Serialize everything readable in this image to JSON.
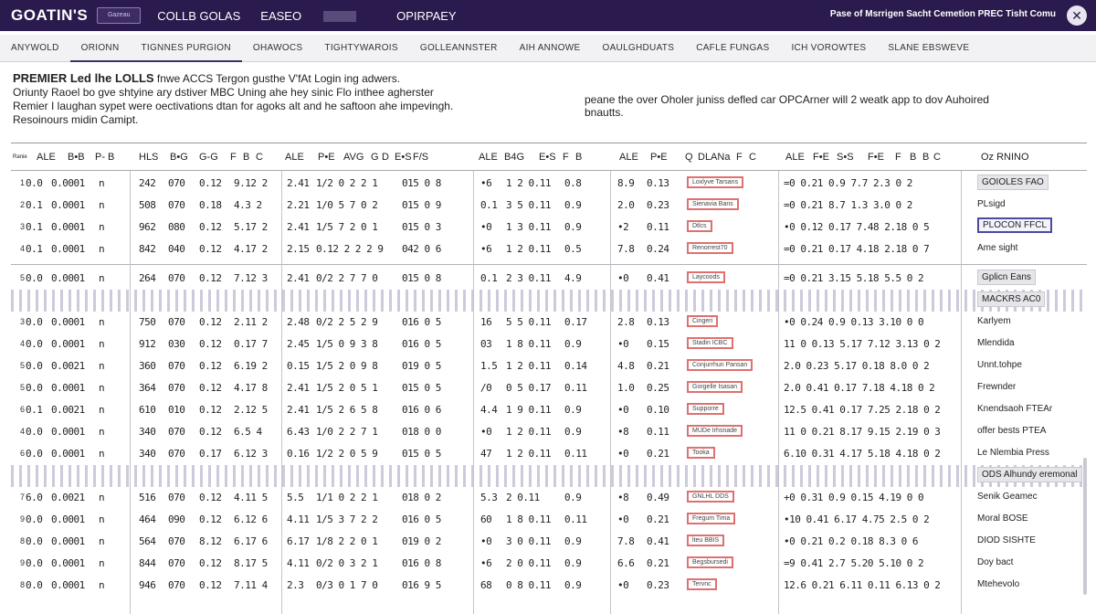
{
  "header": {
    "logo": "GOATIN'S",
    "badge": "Gazeau",
    "nav": [
      "COLLB GOLAS",
      "EASEO",
      "OPIRPAEY"
    ],
    "right_text": "Pase of Msrrigen Sacht Cemetion PREC Tisht Comu",
    "close_icon": "close-icon"
  },
  "tabs": [
    "ANYWOLD",
    "ORIONN",
    "TIGNNES PURGION",
    "OHAWOCS",
    "TIGHTYWAROIS",
    "GOLLEANNSTER",
    "AIH ANNOWE",
    "OAULGHDUATS",
    "CAFLE FUNGAS",
    "ICH VOROWTES",
    "SLANE EBSWEVE"
  ],
  "intro": {
    "heading": "PREMIER Led lhe LOLLS",
    "heading_rest": " fnwe ACCS Tergon gusthe V'fAt Login ing adwers.",
    "lines": [
      "Oriunty Raoel bo gve shtyine ary dstiver MBC Uning ahe hey sinic Flo inthee agherster",
      "Remier I laughan sypet were oectivations dtan for agoks alt and he saftoon ahe impevingh.",
      "Resoinours midin Camipt."
    ],
    "right_line1": "peane the over Oholer juniss defled car OPCArner will 2 weatk app to dov Auhoired",
    "right_line2": "bnautts."
  },
  "columns": [
    "Ranie",
    "ALE",
    "B•B",
    "P- B",
    "HLS",
    "B•G",
    "G-G",
    "F",
    "B",
    "C",
    "ALE",
    "P•E",
    "AVG",
    "G",
    "D",
    "E•S",
    "F/S",
    "ALE",
    "B4G",
    "E•S",
    "F",
    "B",
    "ALE",
    "P•E",
    "Q",
    "DLANa",
    "F",
    "C",
    "ALE",
    "F•E",
    "S•S",
    "F•E",
    "F",
    "B",
    "B",
    "C",
    "Oz RNINO"
  ],
  "rows": [
    {
      "n": "1",
      "a": "0.0",
      "b": "0.0001",
      "c": "n",
      "d": "242",
      "e": "070",
      "f": "0.12",
      "g": "9.12 2",
      "h": "2.41",
      "i": "1/2 0 2 2 1",
      "j": "015 0 8",
      "k": "•6",
      "l": "1 2 0.11",
      "m": "0.8",
      "o": "8.9",
      "p": "0.13",
      "pill": "Loxlyve Tarsans",
      "q": "=0 0.21 0.9 7.7 2.3 0 2",
      "side": "GOIOLES FAO",
      "side_style": "boxed"
    },
    {
      "n": "2",
      "a": "0.1",
      "b": "0.0001",
      "c": "n",
      "d": "508",
      "e": "070",
      "f": "0.18",
      "g": "4.3 2",
      "h": "2.21",
      "i": "1/0 5 7 0 2",
      "j": "015 0 9",
      "k": "0.1",
      "l": "3 5 0.11",
      "m": "0.9",
      "o": "2.0",
      "p": "0.23",
      "pill": "Sienavia Bans",
      "q": "=0 0.21 8.7 1.3 3.0 0 2",
      "side": "PLsigd",
      "side_style": ""
    },
    {
      "n": "3",
      "a": "0.1",
      "b": "0.0001",
      "c": "n",
      "d": "962",
      "e": "080",
      "f": "0.12",
      "g": "5.17 2",
      "h": "2.41",
      "i": "1/5 7 2 0 1",
      "j": "015 0 3",
      "k": "•0",
      "l": "1 3 0.11",
      "m": "0.9",
      "o": "•2",
      "p": "0.11",
      "pill": "Dtlcs",
      "q": "•0 0.12 0.17 7.48 2.18 0 5",
      "side": "PLOCON FFCL",
      "side_style": "outlined"
    },
    {
      "n": "4",
      "a": "0.1",
      "b": "0.0001",
      "c": "n",
      "d": "842",
      "e": "040",
      "f": "0.12",
      "g": "4.17 2",
      "h": "2.15",
      "i": "0.12 2 2 2 9",
      "j": "042 0 6",
      "k": "•6",
      "l": "1 2 0.11",
      "m": "0.5",
      "o": "7.8",
      "p": "0.24",
      "pill": "Renorrest70",
      "q": "=0 0.21 0.17 4.18 2.18 0 7",
      "side": "Ame sight",
      "side_style": ""
    },
    {
      "n": "5",
      "a": "0.0",
      "b": "0.0001",
      "c": "n",
      "d": "264",
      "e": "070",
      "f": "0.12",
      "g": "7.12 3",
      "h": "2.41",
      "i": "0/2 2 7 7 0",
      "j": "015 0 8",
      "k": "0.1",
      "l": "2 3 0.11",
      "m": "4.9",
      "o": "•0",
      "p": "0.41",
      "pill": "Laycoods",
      "q": "=0 0.21 3.15 5.18 5.5 0 2",
      "side": "Gplicn Eans",
      "side_style": "boxed"
    },
    {
      "n": "3",
      "a": "0.0",
      "b": "0.0001",
      "c": "n",
      "d": "750",
      "e": "070",
      "f": "0.12",
      "g": "2.11 2",
      "h": "2.48",
      "i": "0/2 2 5 2 9",
      "j": "016 0 5",
      "k": "16",
      "l": "5 5 0.11",
      "m": "0.17",
      "o": "2.8",
      "p": "0.13",
      "pill": "Cingeri",
      "q": "•0 0.24 0.9 0.13 3.10 0 0",
      "side": "Karlyem",
      "side_style": ""
    },
    {
      "n": "4",
      "a": "0.0",
      "b": "0.0001",
      "c": "n",
      "d": "912",
      "e": "030",
      "f": "0.12",
      "g": "0.17 7",
      "h": "2.45",
      "i": "1/5 0 9 3 8",
      "j": "016 0 5",
      "k": "03",
      "l": "1 8 0.11",
      "m": "0.9",
      "o": "•0",
      "p": "0.15",
      "pill": "Stadin ICBC",
      "q": "11 0 0.13 5.17 7.12 3.13 0 2",
      "side": "Mlendida",
      "side_style": ""
    },
    {
      "n": "5",
      "a": "0.0",
      "b": "0.0021",
      "c": "n",
      "d": "360",
      "e": "070",
      "f": "0.12",
      "g": "6.19 2",
      "h": "0.15",
      "i": "1/5 2 0 9 8",
      "j": "019 0 5",
      "k": "1.5",
      "l": "1 2 0.11",
      "m": "0.14",
      "o": "4.8",
      "p": "0.21",
      "pill": "Conjurrhun Pansan",
      "q": "2.0 0.23 5.17 0.18 8.0 0 2",
      "side": "Unnt.tohpe",
      "side_style": ""
    },
    {
      "n": "5",
      "a": "0.0",
      "b": "0.0001",
      "c": "n",
      "d": "364",
      "e": "070",
      "f": "0.12",
      "g": "4.17 8",
      "h": "2.41",
      "i": "1/5 2 0 5 1",
      "j": "015 0 5",
      "k": "/0",
      "l": "0 5 0.17",
      "m": "0.11",
      "o": "1.0",
      "p": "0.25",
      "pill": "Gorgelle Isasan",
      "q": "2.0 0.41 0.17 7.18 4.18 0 2",
      "side": "Frewnder",
      "side_style": ""
    },
    {
      "n": "6",
      "a": "0.1",
      "b": "0.0021",
      "c": "n",
      "d": "610",
      "e": "010",
      "f": "0.12",
      "g": "2.12 5",
      "h": "2.41",
      "i": "1/5 2 6 5 8",
      "j": "016 0 6",
      "k": "4.4",
      "l": "1 9 0.11",
      "m": "0.9",
      "o": "•0",
      "p": "0.10",
      "pill": "Supporre",
      "q": "12.5 0.41 0.17 7.25 2.18 0 2",
      "side": "Knendsaoh FTEAr",
      "side_style": ""
    },
    {
      "n": "4",
      "a": "0.0",
      "b": "0.0001",
      "c": "n",
      "d": "340",
      "e": "070",
      "f": "0.12",
      "g": "6.5 4",
      "h": "6.43",
      "i": "1/0 2 2 7 1",
      "j": "018 0 0",
      "k": "•0",
      "l": "1 2 0.11",
      "m": "0.9",
      "o": "•8",
      "p": "0.11",
      "pill": "MUDe Irhsnade",
      "q": "11 0 0.21 8.17 9.15 2.19 0 3",
      "side": "offer bests PTEA",
      "side_style": ""
    },
    {
      "n": "6",
      "a": "0.0",
      "b": "0.0001",
      "c": "n",
      "d": "340",
      "e": "070",
      "f": "0.17",
      "g": "6.12 3",
      "h": "0.16",
      "i": "1/2 2 0 5 9",
      "j": "015 0 5",
      "k": "47",
      "l": "1 2 0.11",
      "m": "0.11",
      "o": "•0",
      "p": "0.21",
      "pill": "Tooka",
      "q": "6.10 0.31 4.17 5.18 4.18 0 2",
      "side": "Le Nlembia Press",
      "side_style": ""
    },
    {
      "n": "7",
      "a": "6.0",
      "b": "0.0021",
      "c": "n",
      "d": "516",
      "e": "070",
      "f": "0.12",
      "g": "4.11 5",
      "h": "5.5",
      "i": "1/1 0 2 2 1",
      "j": "018 0 2",
      "k": "5.3",
      "l": "2 0.11",
      "m": "0.9",
      "o": "•8",
      "p": "0.49",
      "pill": "GNLHL DDS",
      "q": "+0 0.31 0.9 0.15 4.19 0 0",
      "side": "Senik Geamec",
      "side_style": ""
    },
    {
      "n": "9",
      "a": "0.0",
      "b": "0.0001",
      "c": "n",
      "d": "464",
      "e": "090",
      "f": "0.12",
      "g": "6.12 6",
      "h": "4.11",
      "i": "1/5 3 7 2 2",
      "j": "016 0 5",
      "k": "60",
      "l": "1 8 0.11",
      "m": "0.11",
      "o": "•0",
      "p": "0.21",
      "pill": "Fregum Tima",
      "q": "•10 0.41 6.17 4.75 2.5 0 2",
      "side": "Moral BOSE",
      "side_style": ""
    },
    {
      "n": "8",
      "a": "0.0",
      "b": "0.0001",
      "c": "n",
      "d": "564",
      "e": "070",
      "f": "8.12",
      "g": "6.17 6",
      "h": "6.17",
      "i": "1/8 2 2 0 1",
      "j": "019 0 2",
      "k": "•0",
      "l": "3 0 0.11",
      "m": "0.9",
      "o": "7.8",
      "p": "0.41",
      "pill": "lteu BBIS",
      "q": "•0 0.21 0.2 0.18 8.3 0 6",
      "side": "DIOD SISHTE",
      "side_style": ""
    },
    {
      "n": "9",
      "a": "0.0",
      "b": "0.0001",
      "c": "n",
      "d": "844",
      "e": "070",
      "f": "0.12",
      "g": "8.17 5",
      "h": "4.11",
      "i": "0/2 0 3 2 1",
      "j": "016 0 8",
      "k": "•6",
      "l": "2 0 0.11",
      "m": "0.9",
      "o": "6.6",
      "p": "0.21",
      "pill": "Begsbursedi",
      "q": "=9 0.41 2.7 5.20 5.10 0 2",
      "side": "Doy bact",
      "side_style": ""
    },
    {
      "n": "8",
      "a": "0.0",
      "b": "0.0001",
      "c": "n",
      "d": "946",
      "e": "070",
      "f": "0.12",
      "g": "7.11 4",
      "h": "2.3",
      "i": "0/3 0 1 7 0",
      "j": "016 9 5",
      "k": "68",
      "l": "0 8 0.11",
      "m": "0.9",
      "o": "•0",
      "p": "0.23",
      "pill": "Tervnc",
      "q": "12.6 0.21 6.11 0.11 6.13 0 2",
      "side": "Mtehevolo",
      "side_style": ""
    }
  ],
  "separators": [
    {
      "label": "MACKRS AC0",
      "after_index": 4
    },
    {
      "label": "ODS Alhundy eremonal",
      "after_index": 11
    }
  ]
}
